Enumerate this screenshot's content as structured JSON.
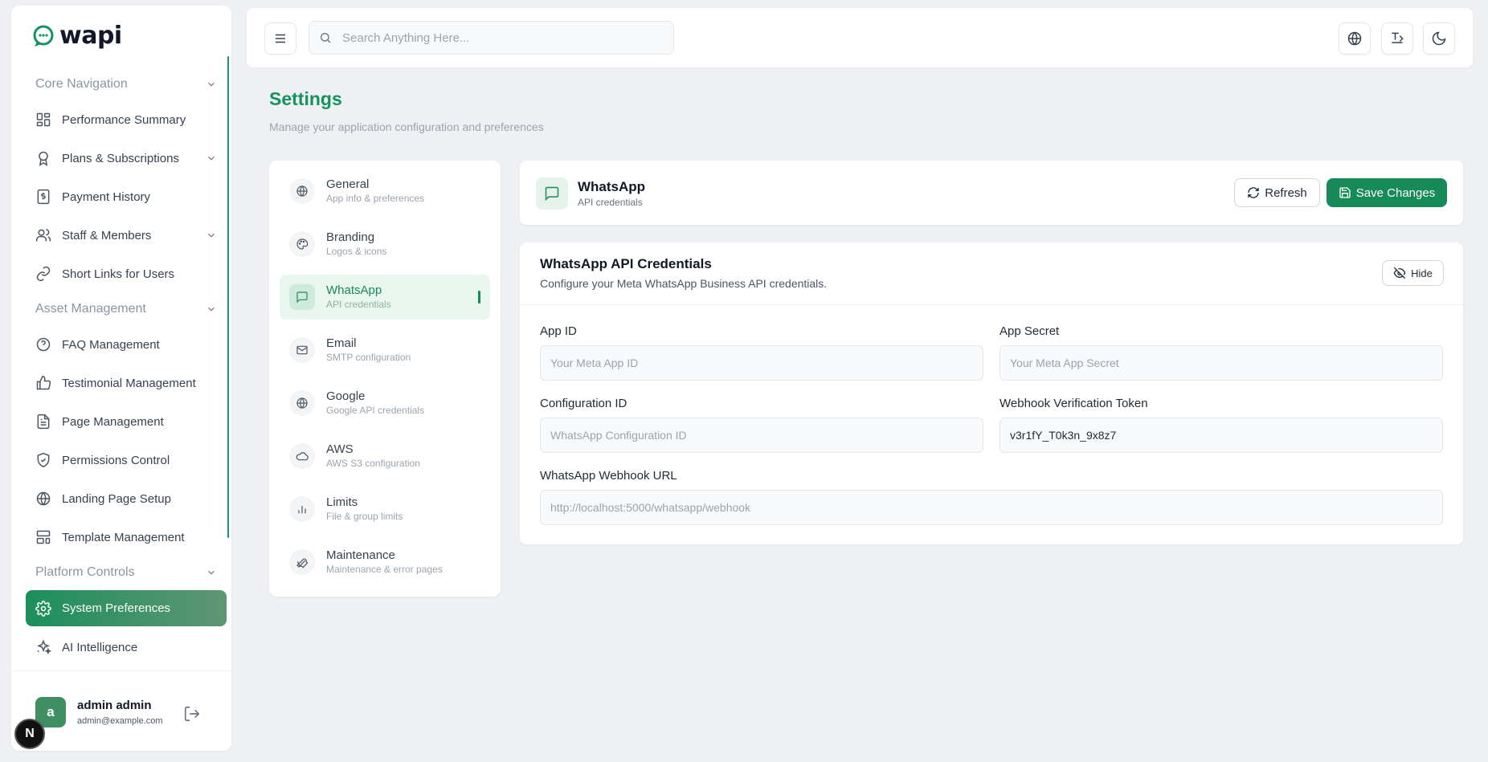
{
  "brand": {
    "name": "wapi"
  },
  "sidebar": {
    "sections": [
      {
        "label": "Core Navigation"
      },
      {
        "label": "Asset Management"
      },
      {
        "label": "Platform Controls"
      }
    ],
    "items": [
      {
        "label": "Performance Summary",
        "icon": "dashboard-icon"
      },
      {
        "label": "Plans & Subscriptions",
        "icon": "award-icon"
      },
      {
        "label": "Payment History",
        "icon": "receipt-icon"
      },
      {
        "label": "Staff & Members",
        "icon": "users-icon"
      },
      {
        "label": "Short Links for Users",
        "icon": "link-icon"
      },
      {
        "label": "FAQ Management",
        "icon": "help-circle-icon"
      },
      {
        "label": "Testimonial Management",
        "icon": "thumbs-up-icon"
      },
      {
        "label": "Page Management",
        "icon": "file-text-icon"
      },
      {
        "label": "Permissions Control",
        "icon": "shield-check-icon"
      },
      {
        "label": "Landing Page Setup",
        "icon": "globe-icon"
      },
      {
        "label": "Template Management",
        "icon": "layout-icon"
      },
      {
        "label": "System Preferences",
        "icon": "gear-icon",
        "active": true
      },
      {
        "label": "AI Intelligence",
        "icon": "sparkles-icon"
      }
    ],
    "user": {
      "initial": "a",
      "name": "admin admin",
      "email": "admin@example.com"
    }
  },
  "topbar": {
    "search_placeholder": "Search Anything Here..."
  },
  "page": {
    "title": "Settings",
    "subtitle": "Manage your application configuration and preferences"
  },
  "tabs": [
    {
      "label": "General",
      "desc": "App info & preferences",
      "icon": "globe-icon"
    },
    {
      "label": "Branding",
      "desc": "Logos & icons",
      "icon": "palette-icon"
    },
    {
      "label": "WhatsApp",
      "desc": "API credentials",
      "icon": "message-icon",
      "active": true
    },
    {
      "label": "Email",
      "desc": "SMTP configuration",
      "icon": "mail-icon"
    },
    {
      "label": "Google",
      "desc": "Google API credentials",
      "icon": "globe-icon"
    },
    {
      "label": "AWS",
      "desc": "AWS S3 configuration",
      "icon": "cloud-icon"
    },
    {
      "label": "Limits",
      "desc": "File & group limits",
      "icon": "bar-chart-icon"
    },
    {
      "label": "Maintenance",
      "desc": "Maintenance & error pages",
      "icon": "wrench-icon"
    }
  ],
  "section": {
    "title": "WhatsApp",
    "subtitle": "API credentials",
    "refresh_label": "Refresh",
    "save_label": "Save Changes"
  },
  "credentials": {
    "title": "WhatsApp API Credentials",
    "subtitle": "Configure your Meta WhatsApp Business API credentials.",
    "hide_label": "Hide",
    "fields": {
      "app_id": {
        "label": "App ID",
        "placeholder": "Your Meta App ID",
        "value": ""
      },
      "app_secret": {
        "label": "App Secret",
        "placeholder": "Your Meta App Secret",
        "value": ""
      },
      "config_id": {
        "label": "Configuration ID",
        "placeholder": "WhatsApp Configuration ID",
        "value": ""
      },
      "webhook_token": {
        "label": "Webhook Verification Token",
        "placeholder": "",
        "value": "v3r1fY_T0k3n_9x8z7"
      },
      "webhook_url": {
        "label": "WhatsApp Webhook URL",
        "placeholder": "http://localhost:5000/whatsapp/webhook",
        "value": ""
      }
    }
  },
  "colors": {
    "accent": "#178a59",
    "accent_light": "#e9f5ef",
    "background": "#eef0f3"
  }
}
